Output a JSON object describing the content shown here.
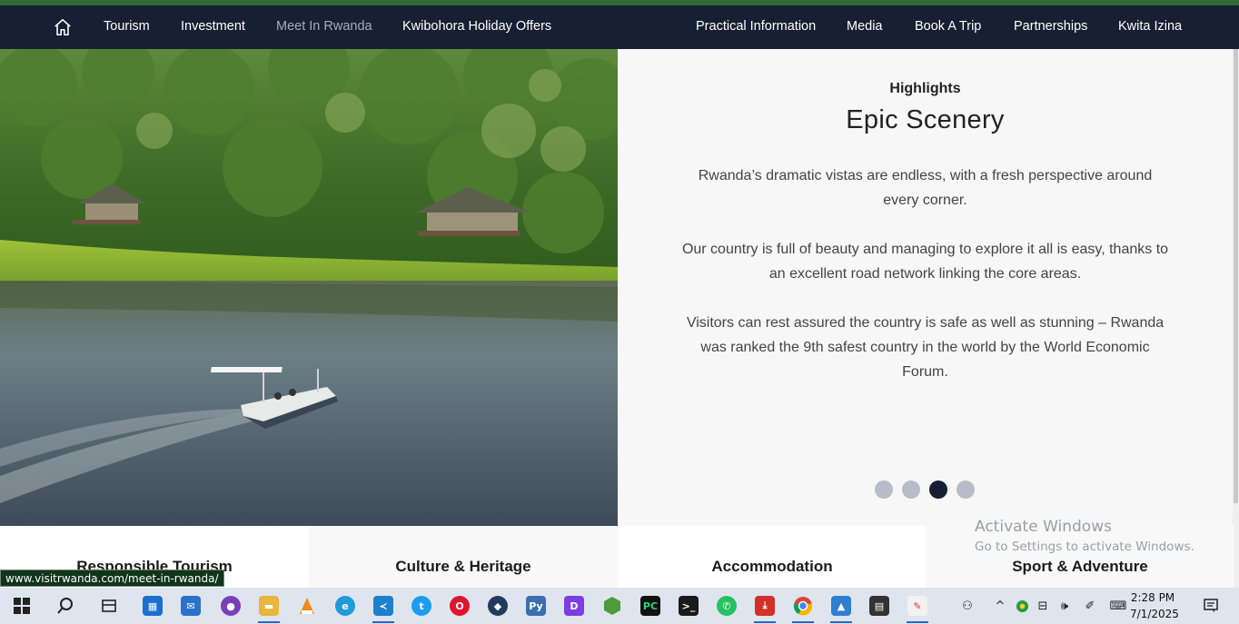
{
  "nav": {
    "left_items": [
      {
        "label": "Tourism"
      },
      {
        "label": "Investment"
      },
      {
        "label": "Meet In Rwanda"
      },
      {
        "label": "Kwibohora Holiday Offers"
      }
    ],
    "right_items": [
      {
        "label": "Practical Information"
      },
      {
        "label": "Media"
      },
      {
        "label": "Book A Trip"
      },
      {
        "label": "Partnerships"
      },
      {
        "label": "Kwita Izina"
      }
    ],
    "active_item": "Meet In Rwanda",
    "home_icon": "home-icon"
  },
  "highlights": {
    "label": "Highlights",
    "title": "Epic Scenery",
    "paragraphs": [
      "Rwanda’s dramatic vistas are endless, with a fresh perspective around every corner.",
      "Our country is full of beauty and managing to explore it all is easy, thanks to an excellent road network linking the core areas.",
      "Visitors can rest assured the country is safe as well as stunning – Rwanda was ranked the 9th safest country in the world by the World Economic Forum."
    ],
    "slide_count": 4,
    "active_slide": 3
  },
  "cards": [
    {
      "label": "Responsible Tourism"
    },
    {
      "label": "Culture & Heritage"
    },
    {
      "label": "Accommodation"
    },
    {
      "label": "Sport & Adventure"
    }
  ],
  "status_url": "www.visitrwanda.com/meet-in-rwanda/",
  "watermark": {
    "line1": "Activate Windows",
    "line2": "Go to Settings to activate Windows."
  },
  "taskbar": {
    "apps": [
      "windows-start-icon",
      "search-icon",
      "task-view-icon",
      "microsoft-store-icon",
      "mail-icon",
      "github-icon",
      "file-explorer-icon",
      "vlc-icon",
      "edge-icon",
      "vscode-icon",
      "twitter-icon",
      "opera-icon",
      "game-icon",
      "python-icon",
      "dpanel-icon",
      "nodejs-icon",
      "pycharm-icon",
      "terminal-icon",
      "whatsapp-icon",
      "pdf-icon",
      "chrome-icon",
      "photos-icon",
      "clapper-icon",
      "paint-icon"
    ],
    "time": "2:28 PM",
    "date": "7/1/2025",
    "colors": {
      "accent": "#2b66c4"
    }
  },
  "colors": {
    "nav_bg": "#172032",
    "top_stripe": "#2e6b35",
    "panel_bg": "#f7f7f8",
    "dot_active": "#172032",
    "dot_inactive": "#b8bcc8"
  }
}
